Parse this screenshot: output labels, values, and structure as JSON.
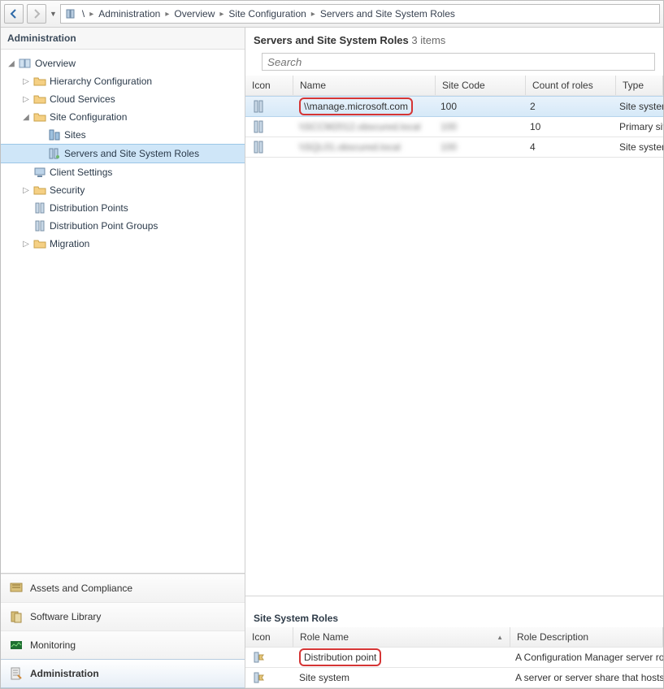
{
  "breadcrumb": {
    "root_glyph": "\\",
    "items": [
      "Administration",
      "Overview",
      "Site Configuration",
      "Servers and Site System Roles"
    ]
  },
  "left": {
    "title": "Administration",
    "tree": [
      {
        "indent": 0,
        "exp": "open",
        "icon": "overview",
        "label": "Overview",
        "sel": false
      },
      {
        "indent": 1,
        "exp": "closed",
        "icon": "folder",
        "label": "Hierarchy Configuration",
        "sel": false
      },
      {
        "indent": 1,
        "exp": "closed",
        "icon": "folder",
        "label": "Cloud Services",
        "sel": false
      },
      {
        "indent": 1,
        "exp": "open",
        "icon": "folder",
        "label": "Site Configuration",
        "sel": false
      },
      {
        "indent": 2,
        "exp": "none",
        "icon": "sites",
        "label": "Sites",
        "sel": false
      },
      {
        "indent": 2,
        "exp": "none",
        "icon": "servers",
        "label": "Servers and Site System Roles",
        "sel": true
      },
      {
        "indent": 1,
        "exp": "none",
        "icon": "client",
        "label": "Client Settings",
        "sel": false
      },
      {
        "indent": 1,
        "exp": "closed",
        "icon": "folder",
        "label": "Security",
        "sel": false
      },
      {
        "indent": 1,
        "exp": "none",
        "icon": "dp",
        "label": "Distribution Points",
        "sel": false
      },
      {
        "indent": 1,
        "exp": "none",
        "icon": "dpg",
        "label": "Distribution Point Groups",
        "sel": false
      },
      {
        "indent": 1,
        "exp": "closed",
        "icon": "folder",
        "label": "Migration",
        "sel": false
      }
    ],
    "wunder": [
      {
        "label": "Assets and Compliance",
        "active": false
      },
      {
        "label": "Software Library",
        "active": false
      },
      {
        "label": "Monitoring",
        "active": false
      },
      {
        "label": "Administration",
        "active": true
      }
    ]
  },
  "right": {
    "title": "Servers and Site System Roles",
    "count_suffix": "3 items",
    "search_placeholder": "Search",
    "columns": [
      "Icon",
      "Name",
      "Site Code",
      "Count of roles",
      "Type"
    ],
    "rows": [
      {
        "name": "\\\\manage.microsoft.com",
        "site": "100",
        "count": "2",
        "type": "Site system server",
        "sel": true,
        "blur": false,
        "hl": true
      },
      {
        "name": "\\\\SCCM2012.obscured.local",
        "site": "100",
        "count": "10",
        "type": "Primary site",
        "sel": false,
        "blur": true,
        "hl": false
      },
      {
        "name": "\\\\SQL01.obscured.local",
        "site": "100",
        "count": "4",
        "type": "Site system server",
        "sel": false,
        "blur": true,
        "hl": false
      }
    ],
    "roles": {
      "title": "Site System Roles",
      "columns": [
        "Icon",
        "Role Name",
        "Role Description"
      ],
      "rows": [
        {
          "name": "Distribution point",
          "desc": "A Configuration Manager server role tha",
          "hl": true
        },
        {
          "name": "Site system",
          "desc": "A server or server share that hosts one o",
          "hl": false
        }
      ]
    }
  }
}
